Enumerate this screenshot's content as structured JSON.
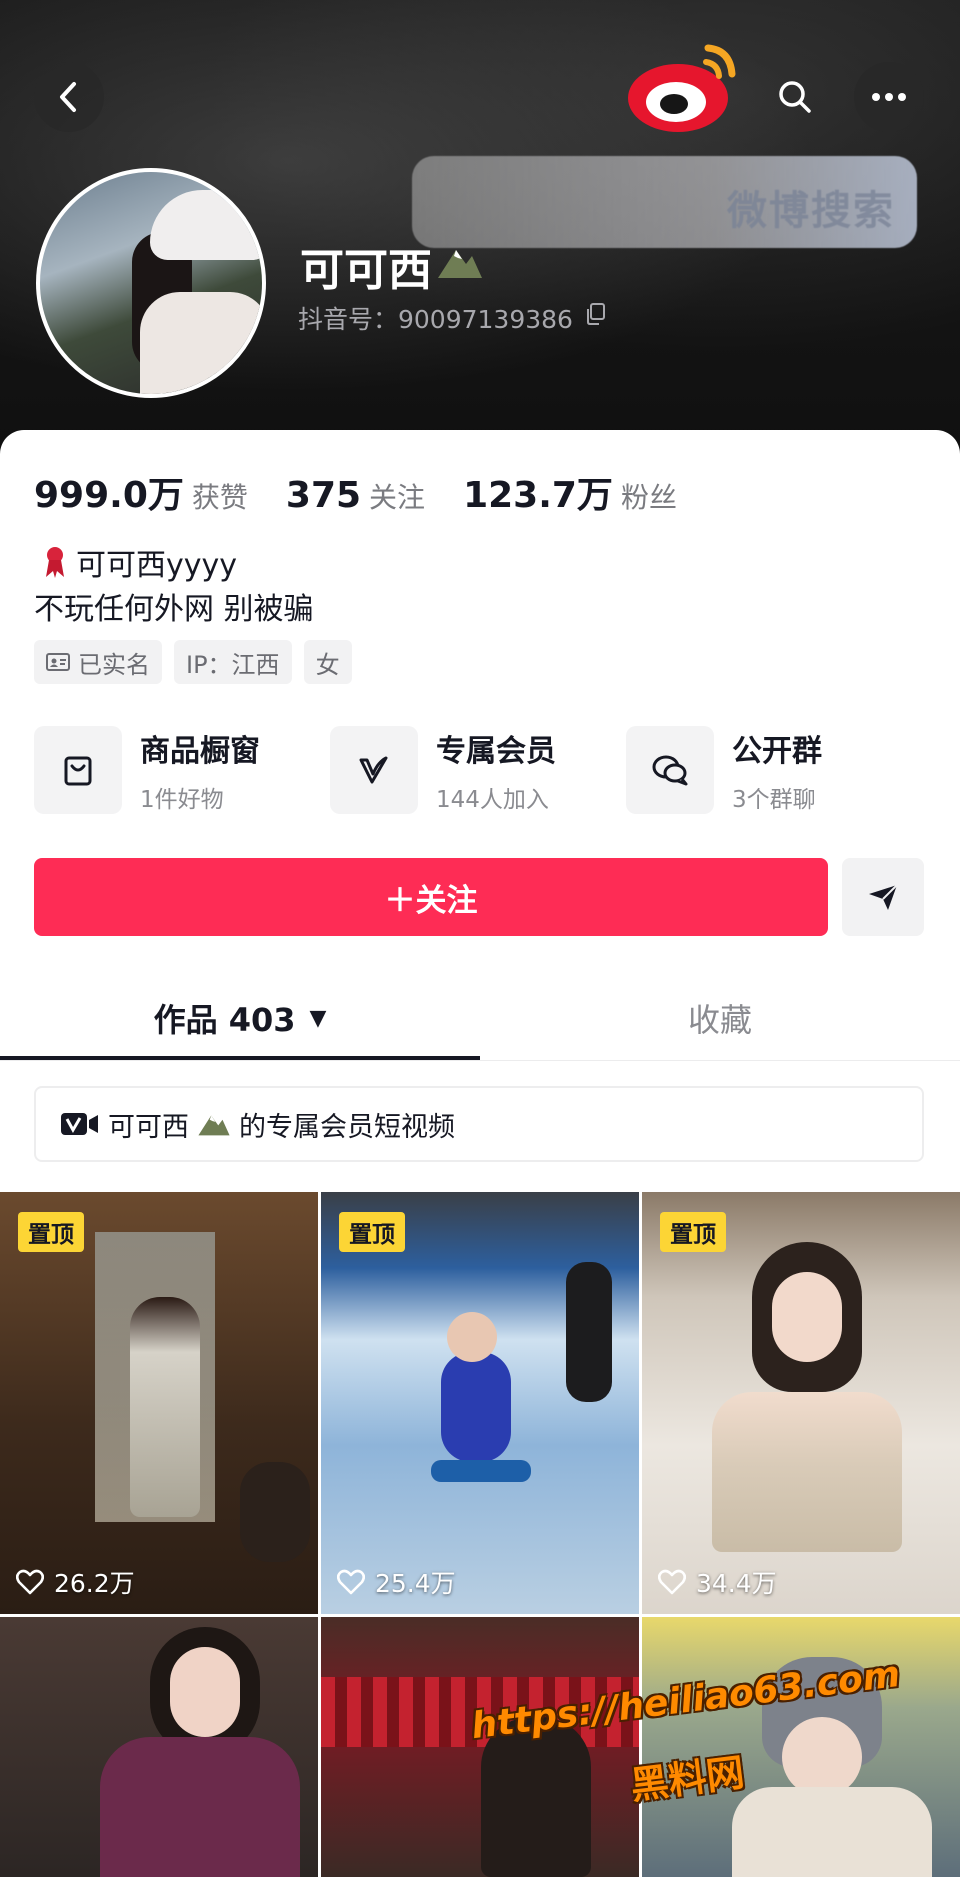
{
  "header": {
    "weibo_search_label": "微博搜索",
    "nickname": "可可西",
    "uid_text": "抖音号：90097139386"
  },
  "stats": [
    {
      "value": "999.0万",
      "label": "获赞"
    },
    {
      "value": "375",
      "label": "关注"
    },
    {
      "value": "123.7万",
      "label": "粉丝"
    }
  ],
  "bio": {
    "line1": "可可西yyyy",
    "line2": "不玩任何外网 别被骗"
  },
  "tags": [
    "已实名",
    "IP：江西",
    "女"
  ],
  "features": [
    {
      "title": "商品橱窗",
      "sub": "1件好物",
      "icon": "bag-icon"
    },
    {
      "title": "专属会员",
      "sub": "144人加入",
      "icon": "vip-v-icon"
    },
    {
      "title": "公开群",
      "sub": "3个群聊",
      "icon": "chat-bubble-icon"
    }
  ],
  "follow_label": "＋关注",
  "tabs": [
    {
      "label": "作品 403",
      "active": true
    },
    {
      "label": "收藏",
      "active": false
    }
  ],
  "vip_banner": {
    "name": "可可西",
    "suffix": "的专属会员短视频"
  },
  "videos": [
    {
      "pinned": "置顶",
      "likes": "26.2万"
    },
    {
      "pinned": "置顶",
      "likes": "25.4万"
    },
    {
      "pinned": "置顶",
      "likes": "34.4万"
    },
    {
      "pinned": "",
      "likes": ""
    },
    {
      "pinned": "",
      "likes": ""
    },
    {
      "pinned": "",
      "likes": ""
    }
  ],
  "watermark": {
    "url": "https://heiliao63.com",
    "text": "黑料网"
  },
  "colors": {
    "accent": "#fe2c55",
    "pin_badge": "#fcd535",
    "header_bg": "#141414"
  }
}
